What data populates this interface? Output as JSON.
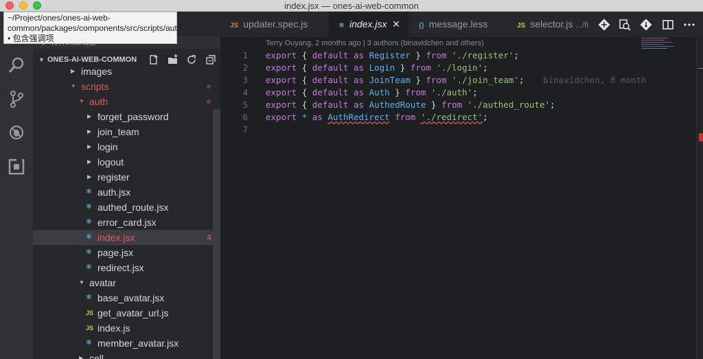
{
  "window": {
    "title": "index.jsx — ones-ai-web-common"
  },
  "tooltip": {
    "text": "~/Project/ones/ones-ai-web-common/packages/components/src/scripts/auth • 包含强调项"
  },
  "sidebar": {
    "open_editors_label": "打开的编辑器",
    "workspace_label": "ONES-AI-WEB-COMMON",
    "tree": [
      {
        "label": "images",
        "type": "folder",
        "state": "collapsed",
        "depth": 1
      },
      {
        "label": "scripts",
        "type": "folder",
        "state": "expanded",
        "depth": 1,
        "modified": true
      },
      {
        "label": "auth",
        "type": "folder",
        "state": "expanded",
        "depth": 2,
        "modified": true
      },
      {
        "label": "forget_password",
        "type": "folder",
        "state": "collapsed",
        "depth": 3
      },
      {
        "label": "join_team",
        "type": "folder",
        "state": "collapsed",
        "depth": 3
      },
      {
        "label": "login",
        "type": "folder",
        "state": "collapsed",
        "depth": 3
      },
      {
        "label": "logout",
        "type": "folder",
        "state": "collapsed",
        "depth": 3
      },
      {
        "label": "register",
        "type": "folder",
        "state": "collapsed",
        "depth": 3
      },
      {
        "label": "auth.jsx",
        "type": "react",
        "depth": 3
      },
      {
        "label": "authed_route.jsx",
        "type": "react",
        "depth": 3
      },
      {
        "label": "error_card.jsx",
        "type": "react",
        "depth": 3
      },
      {
        "label": "index.jsx",
        "type": "react",
        "depth": 3,
        "selected": true,
        "badge": "4"
      },
      {
        "label": "page.jsx",
        "type": "react",
        "depth": 3
      },
      {
        "label": "redirect.jsx",
        "type": "react",
        "depth": 3
      },
      {
        "label": "avatar",
        "type": "folder",
        "state": "expanded",
        "depth": 2
      },
      {
        "label": "base_avatar.jsx",
        "type": "react",
        "depth": 3
      },
      {
        "label": "get_avatar_url.js",
        "type": "js",
        "depth": 3
      },
      {
        "label": "index.js",
        "type": "js",
        "depth": 3
      },
      {
        "label": "member_avatar.jsx",
        "type": "react",
        "depth": 3
      },
      {
        "label": "cell",
        "type": "folder",
        "state": "collapsed",
        "depth": 2
      }
    ]
  },
  "tabs": [
    {
      "label": "updater.spec.js",
      "icon": "JS",
      "kind": "js"
    },
    {
      "label": "index.jsx",
      "icon": "⚛",
      "kind": "react",
      "active": true
    },
    {
      "label": "message.less",
      "icon": "{}",
      "kind": "less"
    },
    {
      "label": "selector.js",
      "icon": "JS",
      "kind": "js",
      "suffix": " .../fi"
    }
  ],
  "editor": {
    "blame": "Terry Ouyang, 2 months ago | 3 authors (binavidchen and others)",
    "ghost_blame": "binavidchen, 8 month",
    "line_numbers": [
      "1",
      "2",
      "3",
      "4",
      "5",
      "6",
      "7"
    ],
    "lines": [
      {
        "name": "Register",
        "path": "'./register'"
      },
      {
        "name": "Login",
        "path": "'./login'"
      },
      {
        "name": "JoinTeam",
        "path": "'./join_team'"
      },
      {
        "name": "Auth",
        "path": "'./auth'"
      },
      {
        "name": "AuthedRoute",
        "path": "'./authed_route'"
      }
    ],
    "line6": {
      "name": "AuthRedirect",
      "path": "'./redirect'"
    },
    "kw_export": "export",
    "kw_default": "default",
    "kw_as": "as",
    "kw_from": "from",
    "star": "*"
  },
  "icons": {
    "activity": [
      "explorer-icon",
      "search-icon",
      "source-control-icon",
      "debug-icon",
      "extensions-icon"
    ],
    "colors": {
      "react": "#5a9fc4",
      "js": "#d6c14a",
      "keyword": "#c678dd",
      "identifier": "#61afef",
      "string": "#98c379",
      "error": "#e05c5c"
    }
  }
}
